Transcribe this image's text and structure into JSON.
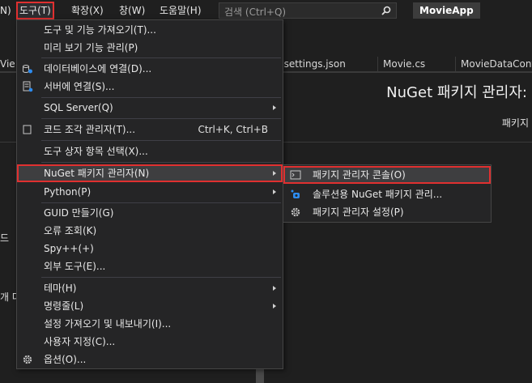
{
  "menubar": {
    "frag": "N)",
    "items": [
      "도구(T)",
      "확장(X)",
      "창(W)",
      "도움말(H)"
    ],
    "search_placeholder": "검색 (Ctrl+Q)",
    "app_name": "MovieApp"
  },
  "tabs": [
    "Vie",
    "psettings.json",
    "Movie.cs",
    "MovieDataConte"
  ],
  "editor": {
    "nuget_title": "NuGet 패키지 관리자:",
    "nuget_sub": "패키지 ",
    "left_frags": [
      "드",
      "개 다"
    ]
  },
  "tools_menu": {
    "items": [
      {
        "label": "도구 및 기능 가져오기(T)...",
        "shortcut": "",
        "icon": ""
      },
      {
        "label": "미리 보기 기능 관리(P)",
        "shortcut": "",
        "icon": ""
      },
      {
        "label": "데이터베이스에 연결(D)...",
        "shortcut": "",
        "icon": "database-connect-icon"
      },
      {
        "label": "서버에 연결(S)...",
        "shortcut": "",
        "icon": "server-connect-icon"
      },
      {
        "label": "SQL Server(Q)",
        "shortcut": "",
        "icon": ""
      },
      {
        "label": "코드 조각 관리자(T)...",
        "shortcut": "Ctrl+K, Ctrl+B",
        "icon": "code-snippet-icon"
      },
      {
        "label": "도구 상자 항목 선택(X)...",
        "shortcut": "",
        "icon": ""
      },
      {
        "label": "NuGet 패키지 관리자(N)",
        "shortcut": "",
        "icon": ""
      },
      {
        "label": "Python(P)",
        "shortcut": "",
        "icon": ""
      },
      {
        "label": "GUID 만들기(G)",
        "shortcut": "",
        "icon": ""
      },
      {
        "label": "오류 조회(K)",
        "shortcut": "",
        "icon": ""
      },
      {
        "label": "Spy++(+)",
        "shortcut": "",
        "icon": ""
      },
      {
        "label": "외부 도구(E)...",
        "shortcut": "",
        "icon": ""
      },
      {
        "label": "테마(H)",
        "shortcut": "",
        "icon": ""
      },
      {
        "label": "명령줄(L)",
        "shortcut": "",
        "icon": ""
      },
      {
        "label": "설정 가져오기 및 내보내기(I)...",
        "shortcut": "",
        "icon": ""
      },
      {
        "label": "사용자 지정(C)...",
        "shortcut": "",
        "icon": ""
      },
      {
        "label": "옵션(O)...",
        "shortcut": "",
        "icon": "gear-icon"
      }
    ]
  },
  "nuget_submenu": {
    "items": [
      {
        "label": "패키지 관리자 콘솔(O)",
        "icon": "console-icon"
      },
      {
        "label": "솔루션용 NuGet 패키지 관리...",
        "icon": "nuget-icon"
      },
      {
        "label": "패키지 관리자 설정(P)",
        "icon": "gear-icon"
      }
    ]
  },
  "colors": {
    "highlight_border": "#e03030",
    "menu_bg": "#252526"
  }
}
